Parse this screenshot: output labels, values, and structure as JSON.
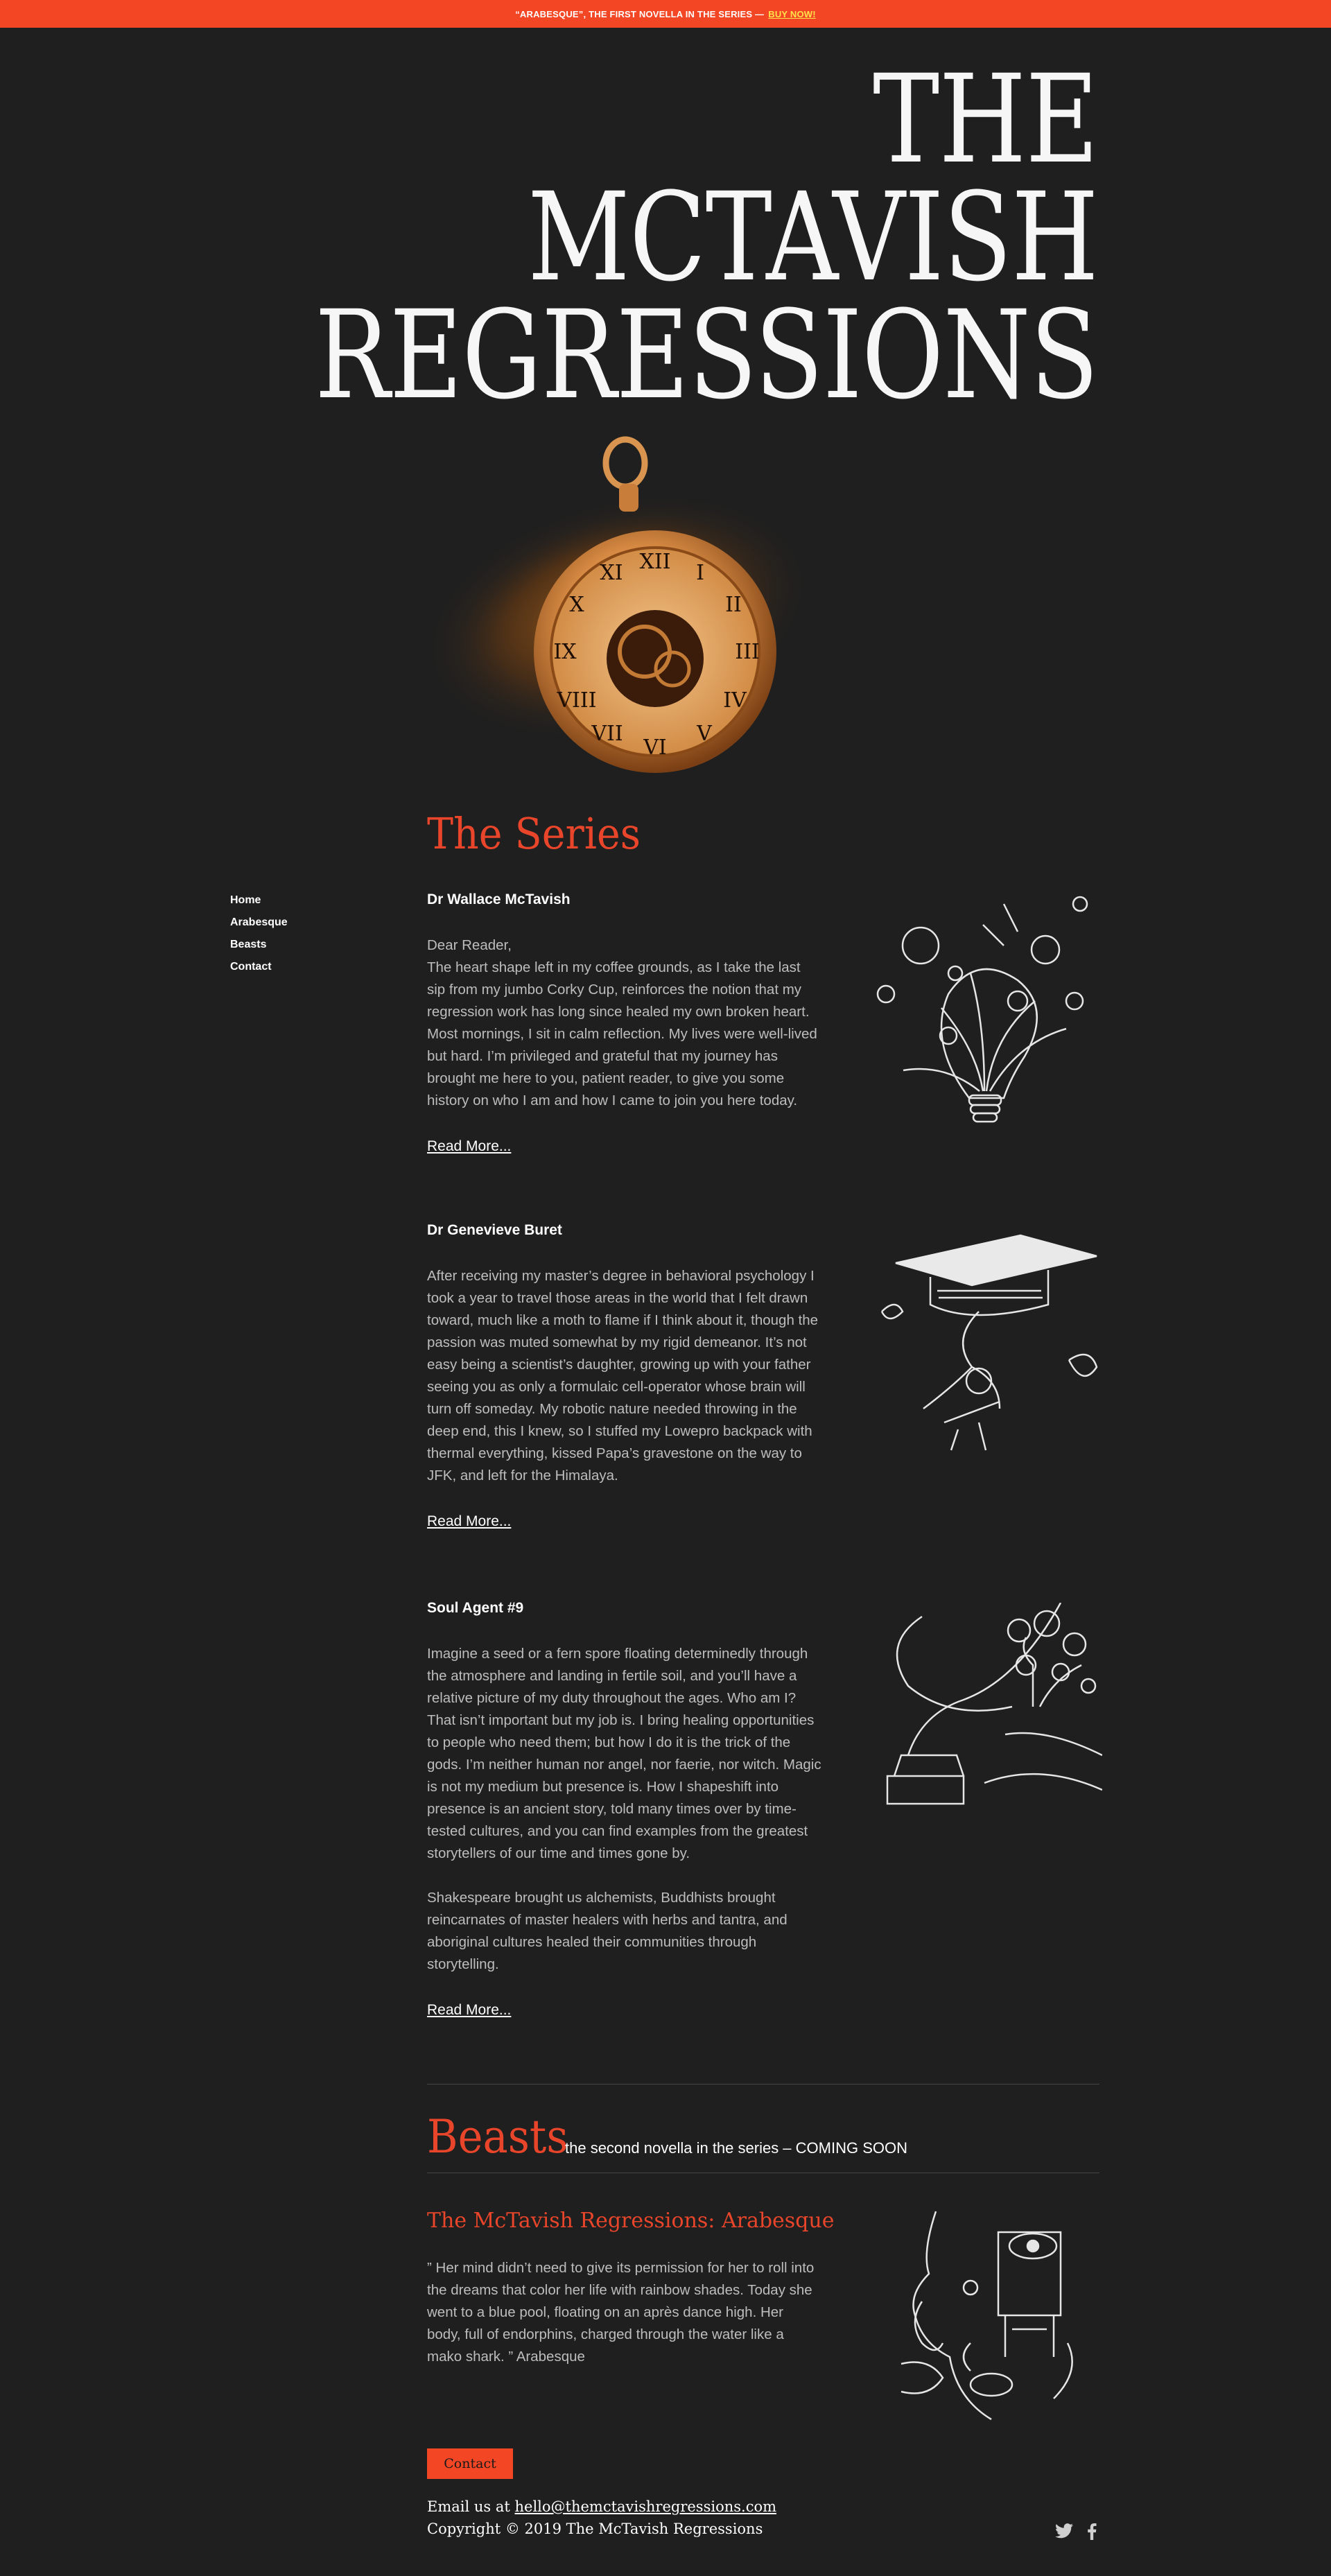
{
  "banner": {
    "text": "“ARABESQUE”, THE FIRST NOVELLA IN THE SERIES —",
    "link": "BUY NOW!"
  },
  "hero": {
    "line1": "THE",
    "line2": "MCTAVISH",
    "line3": "REGRESSIONS"
  },
  "nav": {
    "items": [
      "Home",
      "Arabesque",
      "Beasts",
      "Contact"
    ]
  },
  "series": {
    "heading": "The Series",
    "entries": [
      {
        "title": "Dr Wallace McTavish",
        "paragraphs": [
          "Dear Reader,",
          "The heart shape left in my coffee grounds, as I take the last sip from my jumbo Corky Cup, reinforces the notion that my regression work has long since healed my own broken heart. Most mornings, I sit in calm reflection. My lives were well-lived but hard. I’m privileged and grateful that my journey has brought me here to you, patient reader, to give you some history on who I am and how I came to join you here today."
        ],
        "read_more": "Read More..."
      },
      {
        "title": "Dr Genevieve Buret",
        "paragraphs": [
          "After receiving my master’s degree in behavioral psychology I took a year to travel those areas in the world that I felt drawn toward, much like a moth to flame if I think about it, though the passion was muted somewhat by my rigid demeanor. It’s not easy being a scientist’s daughter, growing up with your father seeing you as only a formulaic cell-operator whose brain will turn off someday. My robotic nature needed throwing in the deep end, this I knew, so I stuffed my Lowepro backpack with thermal everything, kissed Papa’s gravestone on the way to JFK, and left for the Himalaya."
        ],
        "read_more": "Read More..."
      },
      {
        "title": "Soul Agent #9",
        "paragraphs": [
          "Imagine a seed or a fern spore floating determinedly through the atmosphere and landing in fertile soil, and you’ll have a relative picture of my duty throughout the ages. Who am I? That isn’t important but my job is. I bring healing opportunities to people who need them; but how I do it is the trick of the gods. I’m neither human nor angel, nor faerie, nor witch. Magic is not my medium but presence is. How I shapeshift into presence is an ancient story, told many times over by time-tested cultures, and you can find examples from the greatest storytellers of our time and times gone by.",
          "Shakespeare brought us alchemists, Buddhists brought reincarnates of master healers with herbs and tantra, and aboriginal cultures healed their communities through storytelling."
        ],
        "read_more": "Read More..."
      }
    ]
  },
  "beasts": {
    "heading": "Beasts",
    "subtitle": "the second novella in the series – COMING SOON"
  },
  "arabesque": {
    "title": "The McTavish Regressions: Arabesque",
    "quote": "” Her mind didn’t need to give its permission for her to roll into the dreams that color her life with rainbow shades. Today she went to a blue pool, floating on an après dance high. Her body, full of endorphins, charged through the water like a mako shark. ” Arabesque"
  },
  "footer": {
    "contact_button": "Contact",
    "email_prefix": "Email us at",
    "email": "hello@themctavishregressions.com",
    "copyright": "Copyright © 2019 The McTavish Regressions"
  },
  "colors": {
    "background": "#1f1f1f",
    "accent": "#f24624",
    "banner_link": "#ffe24a"
  },
  "icons": {
    "twitter": "twitter-icon",
    "facebook": "facebook-icon"
  }
}
